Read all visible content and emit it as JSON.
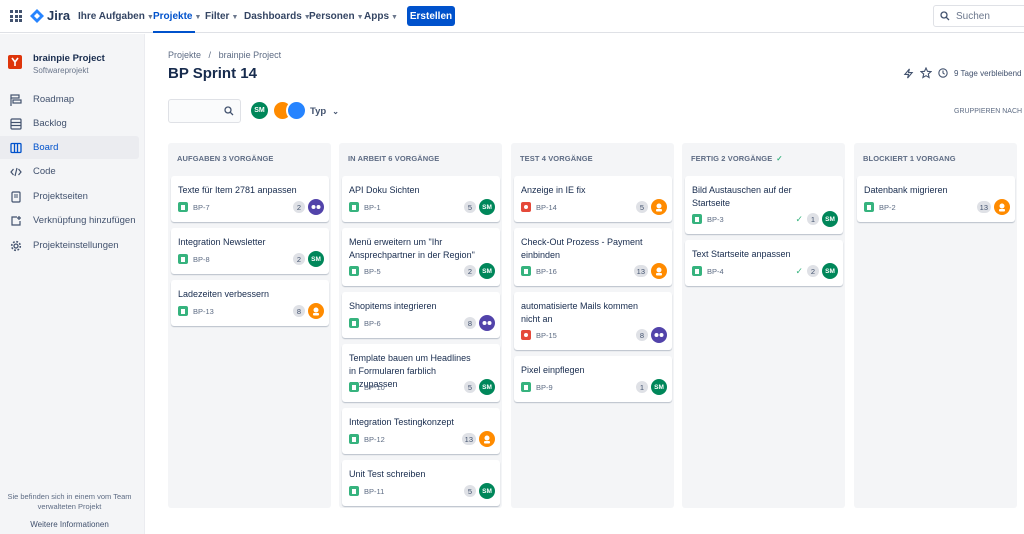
{
  "topnav": {
    "logo": "Jira",
    "items": [
      "Ihre Aufgaben",
      "Projekte",
      "Filter",
      "Dashboards",
      "Personen",
      "Apps"
    ],
    "create": "Erstellen",
    "search_placeholder": "Suchen"
  },
  "sidebar": {
    "project_name": "brainpie Project",
    "project_type": "Softwareprojekt",
    "items": [
      {
        "label": "Roadmap",
        "icon": "roadmap-icon"
      },
      {
        "label": "Backlog",
        "icon": "backlog-icon"
      },
      {
        "label": "Board",
        "icon": "board-icon"
      },
      {
        "label": "Code",
        "icon": "code-icon"
      },
      {
        "label": "Projektseiten",
        "icon": "page-icon"
      },
      {
        "label": "Verknüpfung hinzufügen",
        "icon": "add-link-icon"
      },
      {
        "label": "Projekteinstellungen",
        "icon": "gear-icon"
      }
    ],
    "footer": "Sie befinden sich in einem vom Team verwalteten Projekt",
    "more": "Weitere Informationen"
  },
  "header": {
    "breadcrumb_1": "Projekte",
    "breadcrumb_sep": "/",
    "breadcrumb_2": "brainpie Project",
    "title": "BP Sprint 14",
    "remaining": "9 Tage verbleibend",
    "filter_type": "Typ",
    "group_by": "GRUPPIEREN NACH",
    "avatar_initials": "SM"
  },
  "columns": [
    {
      "title": "AUFGABEN 3 VORGÄNGE",
      "done": false,
      "cards": [
        {
          "title": "Texte für Item 2781 anpassen",
          "key": "BP-7",
          "type": "story",
          "est": "2",
          "avatar": "blue",
          "done": false
        },
        {
          "title": "Integration Newsletter",
          "key": "BP-8",
          "type": "story",
          "est": "2",
          "avatar": "sm",
          "done": false
        },
        {
          "title": "Ladezeiten verbessern",
          "key": "BP-13",
          "type": "story",
          "est": "8",
          "avatar": "orange",
          "done": false
        }
      ]
    },
    {
      "title": "IN ARBEIT 6 VORGÄNGE",
      "done": false,
      "cards": [
        {
          "title": "API Doku Sichten",
          "key": "BP-1",
          "type": "story",
          "est": "5",
          "avatar": "sm",
          "done": false
        },
        {
          "title": "Menü erweitern um \"Ihr Ansprechpartner in der Region\"",
          "key": "BP-5",
          "type": "story",
          "est": "2",
          "avatar": "sm",
          "done": false
        },
        {
          "title": "Shopitems integrieren",
          "key": "BP-6",
          "type": "story",
          "est": "8",
          "avatar": "blue",
          "done": false
        },
        {
          "title": "Template bauen um Headlines in Formularen farblich anzupassen",
          "key": "BP-10",
          "type": "story",
          "est": "5",
          "avatar": "sm",
          "done": false
        },
        {
          "title": "Integration Testingkonzept",
          "key": "BP-12",
          "type": "story",
          "est": "13",
          "avatar": "orange",
          "done": false
        },
        {
          "title": "Unit Test schreiben",
          "key": "BP-11",
          "type": "story",
          "est": "5",
          "avatar": "sm",
          "done": false
        }
      ]
    },
    {
      "title": "TEST 4 VORGÄNGE",
      "done": false,
      "cards": [
        {
          "title": "Anzeige in IE fix",
          "key": "BP-14",
          "type": "bug",
          "est": "5",
          "avatar": "orange",
          "done": false
        },
        {
          "title": "Check-Out Prozess - Payment einbinden",
          "key": "BP-16",
          "type": "story",
          "est": "13",
          "avatar": "orange",
          "done": false
        },
        {
          "title": "automatisierte Mails kommen nicht an",
          "key": "BP-15",
          "type": "bug",
          "est": "8",
          "avatar": "blue",
          "done": false
        },
        {
          "title": "Pixel einpflegen",
          "key": "BP-9",
          "type": "story",
          "est": "1",
          "avatar": "sm",
          "done": false
        }
      ]
    },
    {
      "title": "FERTIG 2 VORGÄNGE",
      "done": true,
      "cards": [
        {
          "title": "Bild Austauschen auf der Startseite",
          "key": "BP-3",
          "type": "story",
          "est": "1",
          "avatar": "sm",
          "done": true
        },
        {
          "title": "Text Startseite anpassen",
          "key": "BP-4",
          "type": "story",
          "est": "2",
          "avatar": "sm",
          "done": true
        }
      ]
    },
    {
      "title": "BLOCKIERT 1 VORGANG",
      "done": false,
      "cards": [
        {
          "title": "Datenbank migrieren",
          "key": "BP-2",
          "type": "story",
          "est": "13",
          "avatar": "orange",
          "done": false
        }
      ]
    }
  ]
}
